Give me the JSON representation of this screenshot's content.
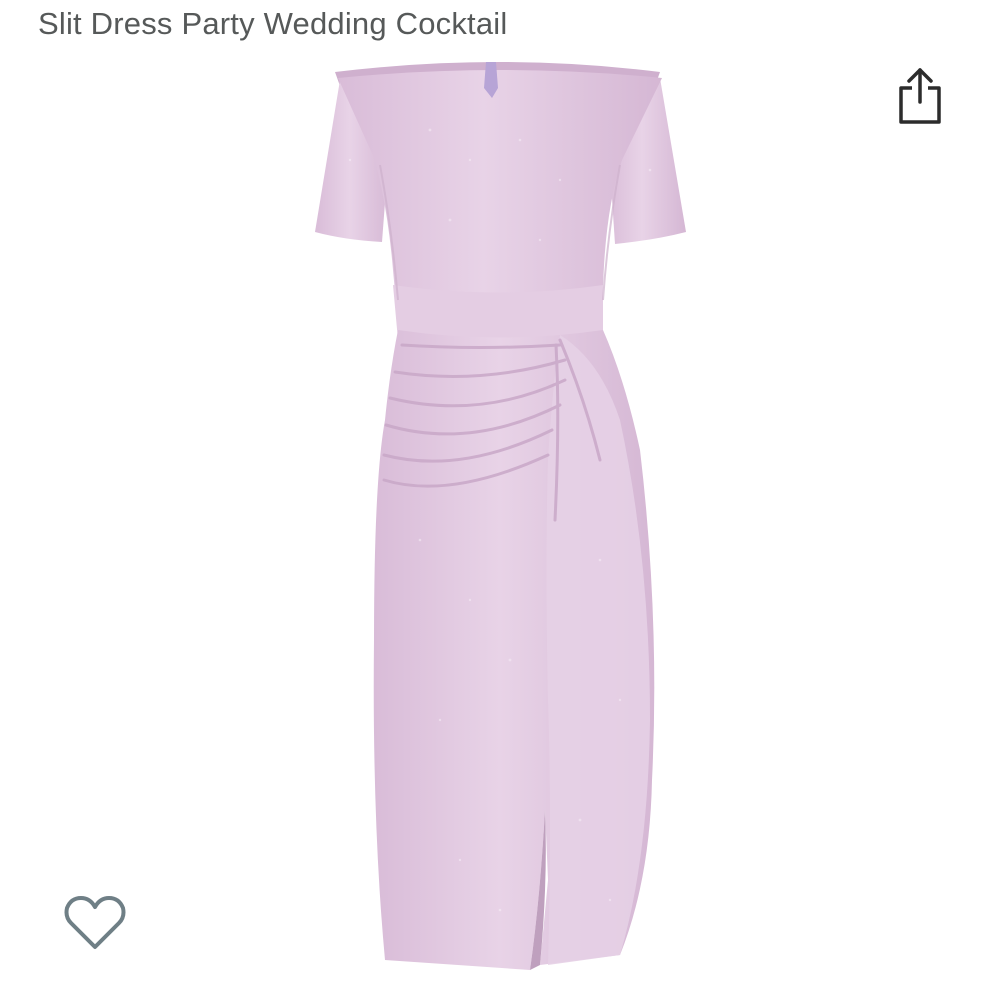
{
  "product": {
    "title": "Slit Dress Party Wedding Cocktail",
    "image_icon": "dress-image",
    "dress_color": "#e2c9e2"
  },
  "actions": {
    "share_icon": "share-icon",
    "wishlist_icon": "heart-outline-icon"
  },
  "colors": {
    "title_text": "#565959",
    "icon_dark": "#2c2c2c",
    "heart_outline": "#6f7f86"
  }
}
